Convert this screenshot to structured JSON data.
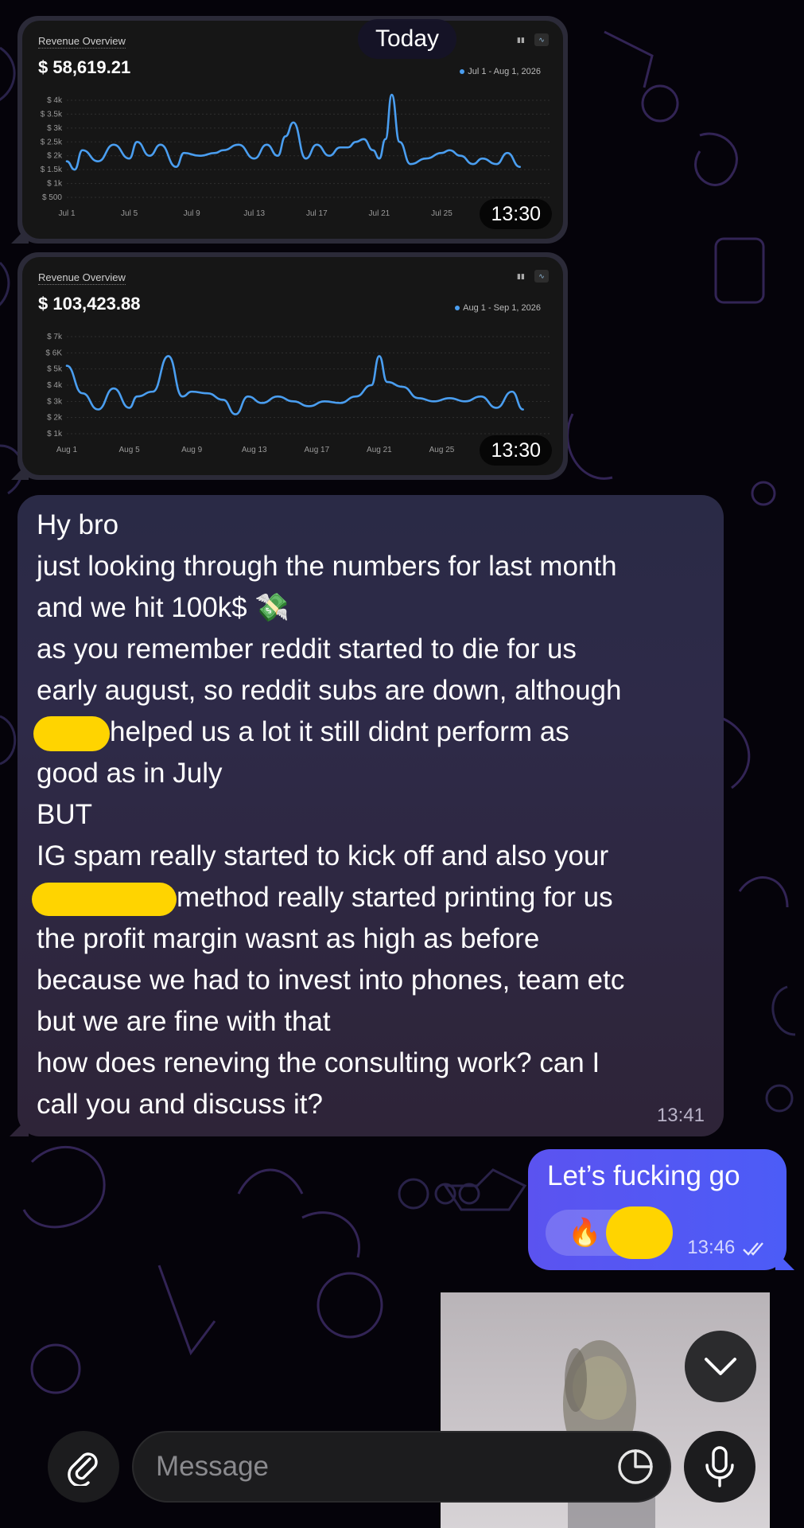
{
  "date_separator": "Today",
  "charts": [
    {
      "card_title": "Revenue Overview",
      "total": "$ 58,619.21",
      "date_range": "Jul 1 - Aug 1, 2026",
      "timestamp": "13:30",
      "chart_data": {
        "type": "line",
        "title": "Revenue Overview",
        "y_tick_labels": [
          "$ 4k",
          "$ 3.5k",
          "$ 3k",
          "$ 2.5k",
          "$ 2k",
          "$ 1.5k",
          "$ 1k",
          "$ 500"
        ],
        "y_ticks": [
          4000,
          3500,
          3000,
          2500,
          2000,
          1500,
          1000,
          500
        ],
        "ylim": [
          500,
          4000
        ],
        "x_tick_labels": [
          "Jul 1",
          "Jul 5",
          "Jul 9",
          "Jul 13",
          "Jul 17",
          "Jul 21",
          "Jul 25"
        ],
        "x_tick_days": [
          1,
          5,
          9,
          13,
          17,
          21,
          25
        ],
        "xlim": [
          1,
          32
        ],
        "grid": true,
        "legend": "top-right",
        "series_color": "#4a9ef0",
        "x": [
          1,
          1.5,
          2,
          3,
          4,
          5,
          5.5,
          6.3,
          7,
          8,
          8.5,
          9.5,
          10.5,
          11,
          12,
          13,
          13.8,
          14.5,
          15,
          15.5,
          16.3,
          17,
          17.8,
          18.5,
          19,
          19.5,
          20,
          20.6,
          21,
          21.4,
          21.8,
          22.3,
          23,
          24,
          25,
          25.5,
          26.2,
          27,
          27.6,
          28.5,
          29.2,
          30
        ],
        "values": [
          1800,
          1500,
          2200,
          1800,
          2400,
          1900,
          2500,
          2000,
          2400,
          1600,
          2100,
          2000,
          2100,
          2200,
          2400,
          1900,
          2400,
          2000,
          2700,
          3200,
          1900,
          2400,
          2000,
          2300,
          2300,
          2500,
          2600,
          2200,
          1900,
          2600,
          4200,
          2500,
          1700,
          1900,
          2100,
          2200,
          2000,
          1700,
          1900,
          1700,
          2100,
          1600
        ]
      }
    },
    {
      "card_title": "Revenue Overview",
      "total": "$ 103,423.88",
      "date_range": "Aug 1 - Sep 1, 2026",
      "timestamp": "13:30",
      "chart_data": {
        "type": "line",
        "title": "Revenue Overview",
        "y_tick_labels": [
          "$ 7k",
          "$ 6K",
          "$ 5k",
          "$ 4k",
          "$ 3k",
          "$ 2k",
          "$ 1k"
        ],
        "y_ticks": [
          7000,
          6000,
          5000,
          4000,
          3000,
          2000,
          1000
        ],
        "ylim": [
          1000,
          7000
        ],
        "x_tick_labels": [
          "Aug 1",
          "Aug 5",
          "Aug 9",
          "Aug 13",
          "Aug 17",
          "Aug 21",
          "Aug 25"
        ],
        "x_tick_days": [
          1,
          5,
          9,
          13,
          17,
          21,
          25
        ],
        "xlim": [
          1,
          32
        ],
        "grid": true,
        "legend": "top-right",
        "series_color": "#4a9ef0",
        "x": [
          1,
          2,
          3,
          4,
          5,
          5.5,
          6.5,
          7.5,
          8.4,
          9,
          10,
          11,
          11.8,
          12.6,
          13.5,
          14.5,
          15.5,
          16.5,
          17.5,
          18.5,
          19.5,
          20.5,
          21,
          21.5,
          22.5,
          23.5,
          24.5,
          25.5,
          26.5,
          27.5,
          28.5,
          29.5,
          30.2
        ],
        "values": [
          5200,
          3500,
          2500,
          3800,
          2600,
          3300,
          3600,
          5800,
          3300,
          3600,
          3500,
          3100,
          2200,
          3300,
          2900,
          3300,
          3000,
          2700,
          3000,
          2900,
          3300,
          4000,
          5800,
          4200,
          3900,
          3200,
          3000,
          3200,
          3000,
          3300,
          2600,
          3600,
          2500
        ]
      }
    }
  ],
  "incoming_message": {
    "lines": [
      "Hy bro",
      "just looking through the numbers for last month",
      "and we hit 100k$",
      "as you remember reddit started to die for us",
      "early august, so reddit subs are down, although",
      "helped us a lot it still didnt perform as",
      "good as in July",
      "BUT",
      "IG spam really started to kick off and also your",
      "method really started printing for us",
      "the profit margin wasnt as high as before",
      "because we had to invest into phones, team etc",
      "but we are fine with that",
      "how does reneving the consulting work? can I",
      "call you and discuss it?"
    ],
    "emoji": "💸",
    "time": "13:41"
  },
  "outgoing_message": {
    "text": "Let’s fucking go",
    "reaction_emoji": "🔥",
    "time": "13:46",
    "status_icon": "double-check-icon"
  },
  "composer": {
    "placeholder": "Message",
    "attach_icon": "paperclip-icon",
    "sticker_icon": "sticker-icon",
    "mic_icon": "microphone-icon",
    "scroll_icon": "chevron-down-icon"
  },
  "colors": {
    "background": "#05030a",
    "outgoing_bubble": "#5b53f0",
    "chart_line": "#4a9ef0",
    "redaction": "#ffd400"
  }
}
